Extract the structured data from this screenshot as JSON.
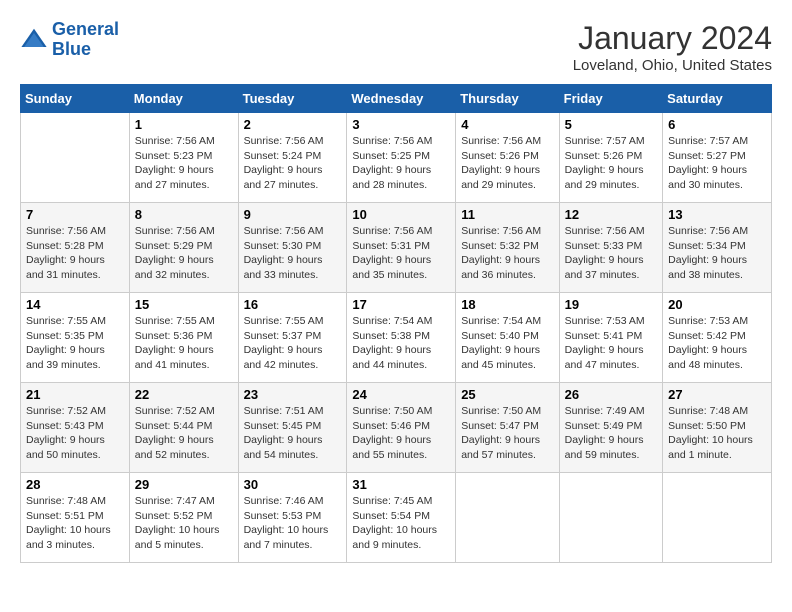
{
  "logo": {
    "line1": "General",
    "line2": "Blue"
  },
  "title": "January 2024",
  "subtitle": "Loveland, Ohio, United States",
  "header": {
    "days": [
      "Sunday",
      "Monday",
      "Tuesday",
      "Wednesday",
      "Thursday",
      "Friday",
      "Saturday"
    ]
  },
  "weeks": [
    [
      {
        "day": "",
        "info": ""
      },
      {
        "day": "1",
        "info": "Sunrise: 7:56 AM\nSunset: 5:23 PM\nDaylight: 9 hours\nand 27 minutes."
      },
      {
        "day": "2",
        "info": "Sunrise: 7:56 AM\nSunset: 5:24 PM\nDaylight: 9 hours\nand 27 minutes."
      },
      {
        "day": "3",
        "info": "Sunrise: 7:56 AM\nSunset: 5:25 PM\nDaylight: 9 hours\nand 28 minutes."
      },
      {
        "day": "4",
        "info": "Sunrise: 7:56 AM\nSunset: 5:26 PM\nDaylight: 9 hours\nand 29 minutes."
      },
      {
        "day": "5",
        "info": "Sunrise: 7:57 AM\nSunset: 5:26 PM\nDaylight: 9 hours\nand 29 minutes."
      },
      {
        "day": "6",
        "info": "Sunrise: 7:57 AM\nSunset: 5:27 PM\nDaylight: 9 hours\nand 30 minutes."
      }
    ],
    [
      {
        "day": "7",
        "info": "Sunrise: 7:56 AM\nSunset: 5:28 PM\nDaylight: 9 hours\nand 31 minutes."
      },
      {
        "day": "8",
        "info": "Sunrise: 7:56 AM\nSunset: 5:29 PM\nDaylight: 9 hours\nand 32 minutes."
      },
      {
        "day": "9",
        "info": "Sunrise: 7:56 AM\nSunset: 5:30 PM\nDaylight: 9 hours\nand 33 minutes."
      },
      {
        "day": "10",
        "info": "Sunrise: 7:56 AM\nSunset: 5:31 PM\nDaylight: 9 hours\nand 35 minutes."
      },
      {
        "day": "11",
        "info": "Sunrise: 7:56 AM\nSunset: 5:32 PM\nDaylight: 9 hours\nand 36 minutes."
      },
      {
        "day": "12",
        "info": "Sunrise: 7:56 AM\nSunset: 5:33 PM\nDaylight: 9 hours\nand 37 minutes."
      },
      {
        "day": "13",
        "info": "Sunrise: 7:56 AM\nSunset: 5:34 PM\nDaylight: 9 hours\nand 38 minutes."
      }
    ],
    [
      {
        "day": "14",
        "info": "Sunrise: 7:55 AM\nSunset: 5:35 PM\nDaylight: 9 hours\nand 39 minutes."
      },
      {
        "day": "15",
        "info": "Sunrise: 7:55 AM\nSunset: 5:36 PM\nDaylight: 9 hours\nand 41 minutes."
      },
      {
        "day": "16",
        "info": "Sunrise: 7:55 AM\nSunset: 5:37 PM\nDaylight: 9 hours\nand 42 minutes."
      },
      {
        "day": "17",
        "info": "Sunrise: 7:54 AM\nSunset: 5:38 PM\nDaylight: 9 hours\nand 44 minutes."
      },
      {
        "day": "18",
        "info": "Sunrise: 7:54 AM\nSunset: 5:40 PM\nDaylight: 9 hours\nand 45 minutes."
      },
      {
        "day": "19",
        "info": "Sunrise: 7:53 AM\nSunset: 5:41 PM\nDaylight: 9 hours\nand 47 minutes."
      },
      {
        "day": "20",
        "info": "Sunrise: 7:53 AM\nSunset: 5:42 PM\nDaylight: 9 hours\nand 48 minutes."
      }
    ],
    [
      {
        "day": "21",
        "info": "Sunrise: 7:52 AM\nSunset: 5:43 PM\nDaylight: 9 hours\nand 50 minutes."
      },
      {
        "day": "22",
        "info": "Sunrise: 7:52 AM\nSunset: 5:44 PM\nDaylight: 9 hours\nand 52 minutes."
      },
      {
        "day": "23",
        "info": "Sunrise: 7:51 AM\nSunset: 5:45 PM\nDaylight: 9 hours\nand 54 minutes."
      },
      {
        "day": "24",
        "info": "Sunrise: 7:50 AM\nSunset: 5:46 PM\nDaylight: 9 hours\nand 55 minutes."
      },
      {
        "day": "25",
        "info": "Sunrise: 7:50 AM\nSunset: 5:47 PM\nDaylight: 9 hours\nand 57 minutes."
      },
      {
        "day": "26",
        "info": "Sunrise: 7:49 AM\nSunset: 5:49 PM\nDaylight: 9 hours\nand 59 minutes."
      },
      {
        "day": "27",
        "info": "Sunrise: 7:48 AM\nSunset: 5:50 PM\nDaylight: 10 hours\nand 1 minute."
      }
    ],
    [
      {
        "day": "28",
        "info": "Sunrise: 7:48 AM\nSunset: 5:51 PM\nDaylight: 10 hours\nand 3 minutes."
      },
      {
        "day": "29",
        "info": "Sunrise: 7:47 AM\nSunset: 5:52 PM\nDaylight: 10 hours\nand 5 minutes."
      },
      {
        "day": "30",
        "info": "Sunrise: 7:46 AM\nSunset: 5:53 PM\nDaylight: 10 hours\nand 7 minutes."
      },
      {
        "day": "31",
        "info": "Sunrise: 7:45 AM\nSunset: 5:54 PM\nDaylight: 10 hours\nand 9 minutes."
      },
      {
        "day": "",
        "info": ""
      },
      {
        "day": "",
        "info": ""
      },
      {
        "day": "",
        "info": ""
      }
    ]
  ]
}
